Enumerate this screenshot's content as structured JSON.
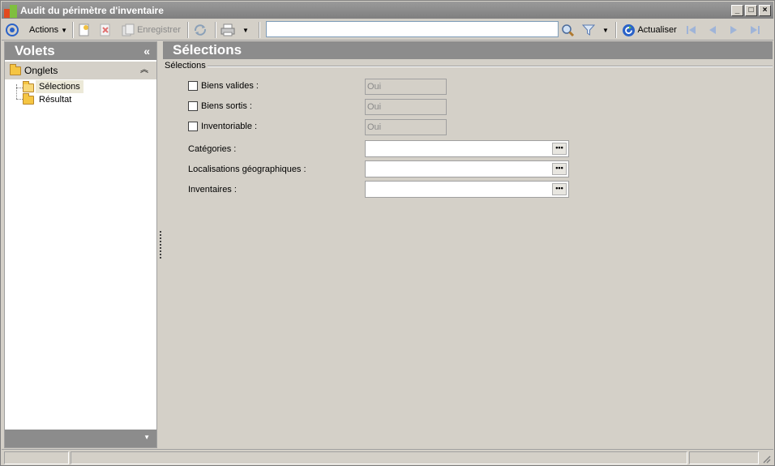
{
  "window": {
    "title": "Audit du périmètre d'inventaire",
    "controls": [
      "minimize-icon",
      "maximize-icon",
      "close-icon"
    ]
  },
  "toolbar": {
    "actions_label": "Actions",
    "save_label": "Enregistrer",
    "search_value": "",
    "refresh_label": "Actualiser"
  },
  "left_panel": {
    "title": "Volets",
    "collapse_glyph": "«",
    "section_title": "Onglets",
    "section_glyph": "≈",
    "tree": [
      {
        "label": "Sélections",
        "selected": true
      },
      {
        "label": "Résultat",
        "selected": false
      }
    ]
  },
  "main": {
    "title": "Sélections",
    "group_label": "Sélections",
    "checkbox_fields": [
      {
        "label": "Biens valides :",
        "value": "Oui",
        "checked": false
      },
      {
        "label": "Biens sortis :",
        "value": "Oui",
        "checked": false
      },
      {
        "label": "Inventoriable :",
        "value": "Oui",
        "checked": false
      }
    ],
    "lookup_fields": [
      {
        "label": "Catégories :",
        "value": ""
      },
      {
        "label": "Localisations géographiques :",
        "value": ""
      },
      {
        "label": "Inventaires :",
        "value": ""
      }
    ]
  },
  "colors": {
    "panel_header": "#8c8c8c",
    "background": "#d4d0c8",
    "accent_blue": "#2a62c8"
  }
}
